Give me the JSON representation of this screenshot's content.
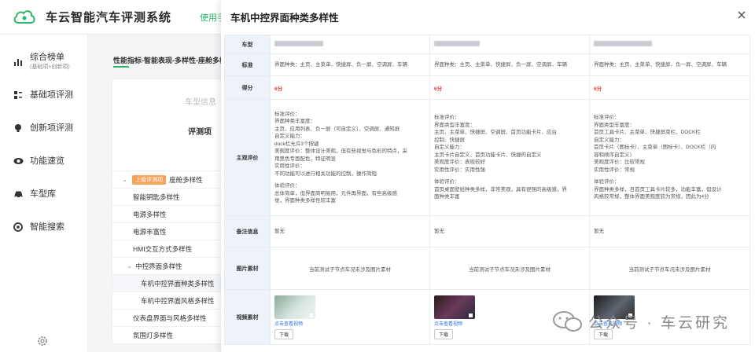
{
  "header": {
    "brand": "车云智能汽车评测系统",
    "manual_link": "使用手册"
  },
  "sidebar": {
    "items": [
      {
        "icon": "bar-chart-icon",
        "label": "综合榜单",
        "sublabel": "(基础项+创新项)"
      },
      {
        "icon": "list-icon",
        "label": "基础项评测"
      },
      {
        "icon": "bulb-icon",
        "label": "创新项评测"
      },
      {
        "icon": "eye-icon",
        "label": "功能速览"
      },
      {
        "icon": "car-icon",
        "label": "车型库"
      },
      {
        "icon": "ai-search-icon",
        "label": "智能搜索"
      }
    ],
    "footer_icon": "gear-icon"
  },
  "main": {
    "breadcrumb": "性能指标-智能表现-多样性-座舱多样性",
    "model_info_label": "车型信息",
    "eval_header": "评测项",
    "tree": [
      {
        "label": "座舱多样性",
        "tag": "上级评测项",
        "level": 0
      },
      {
        "label": "智能钥匙多样性",
        "level": 1
      },
      {
        "label": "电源多样性",
        "level": 1
      },
      {
        "label": "电源丰富性",
        "level": 1
      },
      {
        "label": "HMI交互方式多样性",
        "level": 1
      },
      {
        "label": "中控界面多样性",
        "level": 1
      },
      {
        "label": "车机中控界面种类多样性",
        "level": 2
      },
      {
        "label": "车机中控界面风格多样性",
        "level": 2
      },
      {
        "label": "仪表盘界面与风格多样性",
        "level": 1
      },
      {
        "label": "氛围灯多样性",
        "level": 1
      }
    ]
  },
  "drawer": {
    "title": "车机中控界面种类多样性",
    "row_labels": {
      "model": "车型",
      "criterion": "标准",
      "score": "得分",
      "subjective": "主观评价",
      "notes": "备注信息",
      "image": "图片素材",
      "video": "视频素材"
    },
    "columns": [
      {
        "criterion": "界面种类：主页、主菜单、快捷屏、负一屏、空调屏、车辆",
        "score": "6分",
        "subjective": [
          "标准评价：",
          "界面种类丰富度：",
          "主页、应用列表、负一屏（可自定义）、空调屏、通知屏",
          "自定义能力：",
          "dock栏允许3个按键",
          "美观度评价：整体设计美观，但有些视觉与色彩的特点，采",
          "用黑色专面配色，特征明显",
          "实用性评价：",
          "不同功能可以进行相关功能的控制，操作简短",
          "",
          "体验评价：",
          "总体简单，但界面简明易用，元件再界面，有些高级感",
          "觉，界面种类多样性较丰富"
        ],
        "notes": "暂无",
        "image_note": "当前测试子节点车况未涉及图片素材",
        "video_link": "点击查看视频",
        "download": "下载"
      },
      {
        "criterion": "界面种类：主页、主菜单、快捷屏、负一屏、空调屏、车辆",
        "score": "6分",
        "subjective": [
          "标准评价：",
          "界面类型丰富度：",
          "主页、主菜单、快捷屏、空调屏、首页功能卡片、应台",
          "控制、快捷屏",
          "自定义能力：",
          "主页卡片自定义、首页功能卡片、快捷的自定义",
          "美观度评价：表现较好",
          "实用性评价：实用性强",
          "",
          "体验评价：",
          "首页桌面壁纸种类多样，非常美观，具有很强的高级感，界",
          "面种类丰富"
        ],
        "notes": "暂无",
        "image_note": "当前测试子节点车况未涉及图片素材",
        "video_link": "点击查看视频",
        "download": "下载"
      },
      {
        "criterion": "界面种类：主页、主菜单、快捷屏、负一屏、空调屏、车辆",
        "score": "6分",
        "subjective": [
          "标准评价：",
          "界面类型丰富度：",
          "首页工具卡片、主菜单、快捷屏菜栏、DOCK栏",
          "自定义能力：",
          "首页卡片（图标卡）、主菜单（图标卡）、DOCK栏（内",
          "容和顺序自定义）",
          "美观度评价：比较常规",
          "实用性评价：常规",
          "",
          "体验评价：",
          "界面种类多样，且首页工具卡片较多，功能丰富，但设计",
          "风格较常规，整体界面美观度较为常规，因此为4分"
        ],
        "notes": "暂无",
        "image_note": "当前测试子节点车况未涉及图片素材",
        "video_link": "点击查看视频",
        "download": "下载"
      }
    ],
    "close_icon": "close-icon"
  },
  "watermark": {
    "text": "公众号 · 车云研究"
  },
  "colors": {
    "accent_green": "#2bb56a",
    "score_red": "#e23b3b",
    "tag_orange": "#f6a35a",
    "label_bg": "#eef3fa",
    "link_blue": "#2b6fe0"
  }
}
